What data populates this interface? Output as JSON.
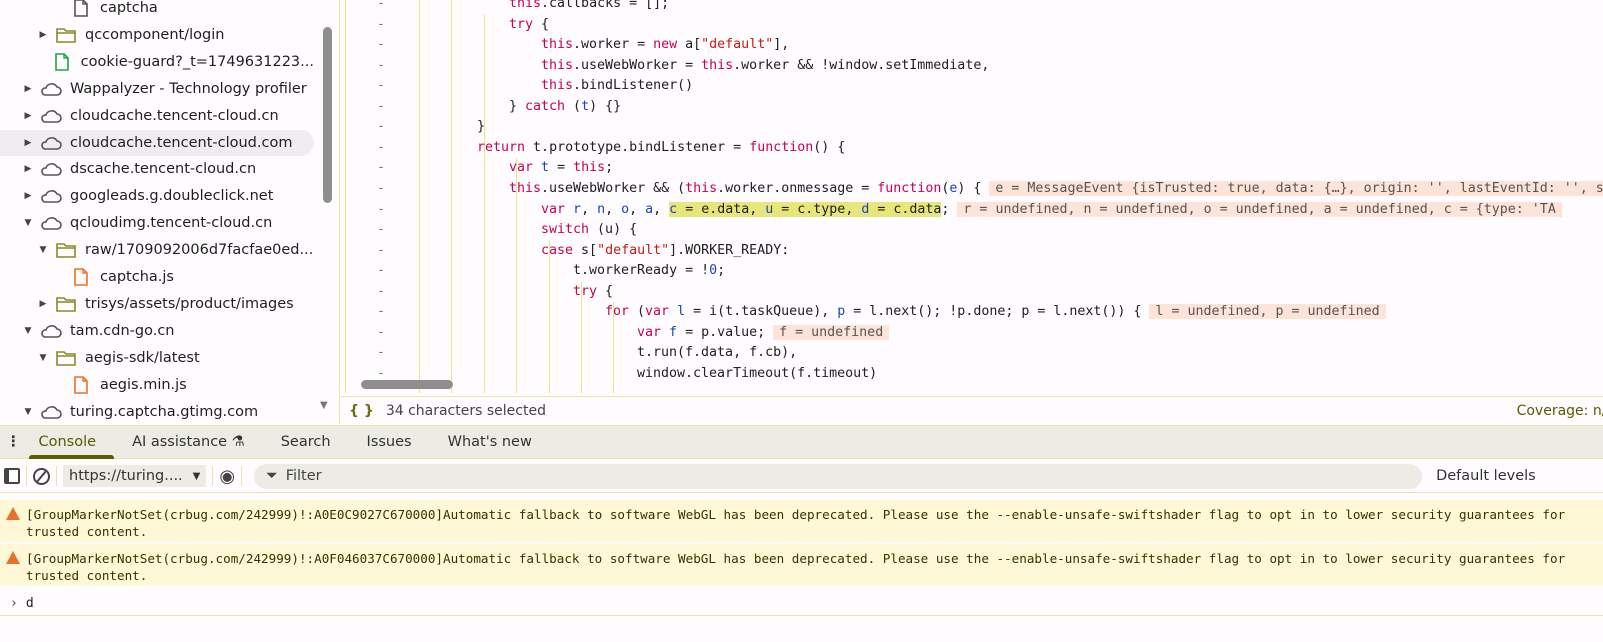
{
  "sidebar": {
    "items": [
      {
        "label": "captcha",
        "indent": 3,
        "arrow": "",
        "icon": "file",
        "color": "#555"
      },
      {
        "label": "qccomponent/login",
        "indent": 2,
        "arrow": "right",
        "icon": "folder",
        "color": "#8a8a28"
      },
      {
        "label": "cookie-guard?_t=1749631223...",
        "indent": 2.5,
        "arrow": "",
        "icon": "file",
        "color": "#1ea446"
      },
      {
        "label": "Wappalyzer - Technology profiler",
        "indent": 1,
        "arrow": "right",
        "icon": "cloud",
        "color": "#555"
      },
      {
        "label": "cloudcache.tencent-cloud.cn",
        "indent": 1,
        "arrow": "right",
        "icon": "cloud",
        "color": "#555"
      },
      {
        "label": "cloudcache.tencent-cloud.com",
        "indent": 1,
        "arrow": "right",
        "icon": "cloud",
        "color": "#555",
        "selected": true
      },
      {
        "label": "dscache.tencent-cloud.cn",
        "indent": 1,
        "arrow": "right",
        "icon": "cloud",
        "color": "#555"
      },
      {
        "label": "googleads.g.doubleclick.net",
        "indent": 1,
        "arrow": "right",
        "icon": "cloud",
        "color": "#555"
      },
      {
        "label": "qcloudimg.tencent-cloud.cn",
        "indent": 1,
        "arrow": "down",
        "icon": "cloud",
        "color": "#555"
      },
      {
        "label": "raw/1709092006d7facfae0ed...",
        "indent": 2,
        "arrow": "down",
        "icon": "folder",
        "color": "#8a8a28"
      },
      {
        "label": "captcha.js",
        "indent": 3,
        "arrow": "",
        "icon": "file",
        "color": "#f07020"
      },
      {
        "label": "trisys/assets/product/images",
        "indent": 2,
        "arrow": "right",
        "icon": "folder",
        "color": "#8a8a28"
      },
      {
        "label": "tam.cdn-go.cn",
        "indent": 1,
        "arrow": "down",
        "icon": "cloud",
        "color": "#555"
      },
      {
        "label": "aegis-sdk/latest",
        "indent": 2,
        "arrow": "down",
        "icon": "folder",
        "color": "#8a8a28"
      },
      {
        "label": "aegis.min.js",
        "indent": 3,
        "arrow": "",
        "icon": "file",
        "color": "#f07020"
      },
      {
        "label": "turing.captcha.gtimg.com",
        "indent": 1,
        "arrow": "down",
        "icon": "cloud",
        "color": "#555"
      }
    ]
  },
  "editor": {
    "lines": [
      {
        "level": 3,
        "seg": [
          [
            "this",
            "kw"
          ],
          [
            ".callbacks = [];",
            "plain"
          ]
        ]
      },
      {
        "level": 3,
        "seg": [
          [
            "try",
            "kw"
          ],
          [
            " {",
            "plain"
          ]
        ]
      },
      {
        "level": 4,
        "seg": [
          [
            "this",
            "kw"
          ],
          [
            ".worker = ",
            "plain"
          ],
          [
            "new",
            "kw"
          ],
          [
            " a[",
            "plain"
          ],
          [
            "\"default\"",
            "str"
          ],
          [
            "],",
            "plain"
          ]
        ]
      },
      {
        "level": 4,
        "seg": [
          [
            "this",
            "kw"
          ],
          [
            ".useWebWorker = ",
            "plain"
          ],
          [
            "this",
            "kw"
          ],
          [
            ".worker && !window.setImmediate,",
            "plain"
          ]
        ]
      },
      {
        "level": 4,
        "seg": [
          [
            "this",
            "kw"
          ],
          [
            ".bindListener()",
            "plain"
          ]
        ]
      },
      {
        "level": 3,
        "seg": [
          [
            "} ",
            "plain"
          ],
          [
            "catch",
            "kw"
          ],
          [
            " (",
            "plain"
          ],
          [
            "t",
            "var"
          ],
          [
            ") {}",
            "plain"
          ]
        ]
      },
      {
        "level": 2,
        "seg": [
          [
            "}",
            "plain"
          ]
        ]
      },
      {
        "level": 2,
        "seg": [
          [
            "return",
            "kw"
          ],
          [
            " t.prototype.bindListener = ",
            "plain"
          ],
          [
            "function",
            "kw"
          ],
          [
            "() {",
            "plain"
          ]
        ]
      },
      {
        "level": 3,
        "seg": [
          [
            "var",
            "kw"
          ],
          [
            " ",
            "plain"
          ],
          [
            "t",
            "var"
          ],
          [
            " = ",
            "plain"
          ],
          [
            "this",
            "kw"
          ],
          [
            ";",
            "plain"
          ]
        ]
      },
      {
        "level": 3,
        "seg": [
          [
            "this",
            "kw"
          ],
          [
            ".useWebWorker && (",
            "plain"
          ],
          [
            "this",
            "kw"
          ],
          [
            ".worker.onmessage = ",
            "plain"
          ],
          [
            "function",
            "kw"
          ],
          [
            "(",
            "plain"
          ],
          [
            "e",
            "var"
          ],
          [
            ") {",
            "plain"
          ]
        ],
        "inline": "e = MessageEvent {isTrusted: true, data: {…}, origin: '', lastEventId: '', source: null, …}"
      },
      {
        "level": 4,
        "seg": [
          [
            "var",
            "kw"
          ],
          [
            " ",
            "plain"
          ],
          [
            "r",
            "var"
          ],
          [
            ", ",
            "plain"
          ],
          [
            "n",
            "var"
          ],
          [
            ", ",
            "plain"
          ],
          [
            "o",
            "var"
          ],
          [
            ", ",
            "plain"
          ],
          [
            "a",
            "var"
          ],
          [
            ", ",
            "plain"
          ],
          [
            "c",
            "var selh"
          ],
          [
            " = e.data, ",
            "plain selh"
          ],
          [
            "u",
            "var selh"
          ],
          [
            " = c.type, ",
            "plain selh"
          ],
          [
            "d",
            "var selh"
          ],
          [
            " = c.data",
            "plain selh"
          ],
          [
            ";",
            "plain"
          ]
        ],
        "inline": "r = undefined, n = undefined, o = undefined, a = undefined, c = {type: 'TA"
      },
      {
        "level": 4,
        "seg": [
          [
            "switch",
            "kw"
          ],
          [
            " (u) {",
            "plain"
          ]
        ]
      },
      {
        "level": 4,
        "seg": [
          [
            "case",
            "kw"
          ],
          [
            " s[",
            "plain"
          ],
          [
            "\"default\"",
            "str"
          ],
          [
            "].WORKER_READY:",
            "plain"
          ]
        ]
      },
      {
        "level": 5,
        "seg": [
          [
            "t.workerReady = !",
            "plain"
          ],
          [
            "0",
            "num"
          ],
          [
            ";",
            "plain"
          ]
        ]
      },
      {
        "level": 5,
        "seg": [
          [
            "try",
            "kw"
          ],
          [
            " {",
            "plain"
          ]
        ]
      },
      {
        "level": 6,
        "seg": [
          [
            "for",
            "kw"
          ],
          [
            " (",
            "plain"
          ],
          [
            "var",
            "kw"
          ],
          [
            " ",
            "plain"
          ],
          [
            "l",
            "var"
          ],
          [
            " = i(t.taskQueue), ",
            "plain"
          ],
          [
            "p",
            "var"
          ],
          [
            " = l.next(); !p.done; p = l.next()) {",
            "plain"
          ]
        ],
        "inline": "l = undefined, p = undefined"
      },
      {
        "level": 7,
        "seg": [
          [
            "var",
            "kw"
          ],
          [
            " ",
            "plain"
          ],
          [
            "f",
            "var"
          ],
          [
            " = p.value;",
            "plain"
          ]
        ],
        "inline": "f = undefined"
      },
      {
        "level": 7,
        "seg": [
          [
            "t.run(f.data, f.cb),",
            "plain"
          ]
        ]
      },
      {
        "level": 7,
        "seg": [
          [
            "window.clearTimeout(f.timeout)",
            "plain"
          ]
        ]
      }
    ]
  },
  "status": {
    "icon": "{ }",
    "selection": "34 characters selected",
    "coverage": "Coverage: n/a"
  },
  "tabs": [
    {
      "label": "Console",
      "active": true
    },
    {
      "label": "AI assistance ⚗"
    },
    {
      "label": "Search"
    },
    {
      "label": "Issues"
    },
    {
      "label": "What's new"
    }
  ],
  "toolbar": {
    "context": "https://turing....",
    "filter_placeholder": "Filter",
    "levels": "Default levels"
  },
  "console": {
    "messages": [
      "[GroupMarkerNotSet(crbug.com/242999)!:A0E0C9027C670000]Automatic fallback to software WebGL has been deprecated. Please use the --enable-unsafe-swiftshader flag to opt in to lower security guarantees for\ntrusted content.",
      "[GroupMarkerNotSet(crbug.com/242999)!:A0F046037C670000]Automatic fallback to software WebGL has been deprecated. Please use the --enable-unsafe-swiftshader flag to opt in to lower security guarantees for\ntrusted content."
    ],
    "prompt_input": "d"
  }
}
